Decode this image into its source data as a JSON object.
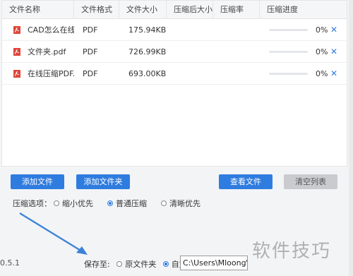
{
  "table": {
    "headers": [
      "文件名称",
      "文件格式",
      "文件大小",
      "压缩后大小",
      "压缩率",
      "压缩进度"
    ],
    "rows": [
      {
        "name": "CAD怎么在线...",
        "format": "PDF",
        "size": "175.94KB",
        "compressed_size": "",
        "ratio": "",
        "progress": 0,
        "progress_label": "0%",
        "remove": "✕"
      },
      {
        "name": "文件夹.pdf",
        "format": "PDF",
        "size": "726.99KB",
        "compressed_size": "",
        "ratio": "",
        "progress": 0,
        "progress_label": "0%",
        "remove": "✕"
      },
      {
        "name": "在线压缩PDF...",
        "format": "PDF",
        "size": "693.00KB",
        "compressed_size": "",
        "ratio": "",
        "progress": 0,
        "progress_label": "0%",
        "remove": "✕"
      }
    ]
  },
  "buttons": {
    "add_file": "添加文件",
    "add_folder": "添加文件夹",
    "view_files": "查看文件",
    "clear_list": "清空列表"
  },
  "compress_options": {
    "label": "压缩选项：",
    "options": [
      {
        "label": "缩小优先",
        "selected": false
      },
      {
        "label": "普通压缩",
        "selected": true
      },
      {
        "label": "清晰优先",
        "selected": false
      }
    ]
  },
  "save": {
    "label": "保存至:",
    "options": [
      {
        "label": "原文件夹",
        "selected": false
      },
      {
        "label": "自定义",
        "selected": true
      }
    ],
    "path": "C:\\Users\\Mloong\\Do"
  },
  "version": "0.5.1",
  "watermark": "软件技巧",
  "colors": {
    "accent": "#2f7ce0",
    "icon_red": "#e0463b",
    "arrow": "#3b82d6"
  },
  "icons": {
    "file": "pdf-file-icon",
    "remove": "close-icon"
  }
}
